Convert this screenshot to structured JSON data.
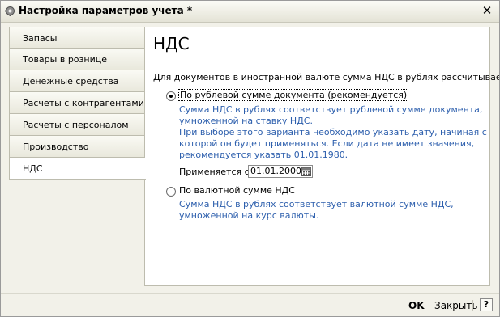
{
  "window": {
    "title": "Настройка параметров учета *",
    "icon": "gear-icon",
    "close_icon": "close-icon"
  },
  "tabs": [
    {
      "label": "Запасы"
    },
    {
      "label": "Товары в рознице"
    },
    {
      "label": "Денежные средства"
    },
    {
      "label": "Расчеты с контрагентами"
    },
    {
      "label": "Расчеты с персоналом"
    },
    {
      "label": "Производство"
    },
    {
      "label": "НДС",
      "active": true
    }
  ],
  "panel": {
    "title": "НДС",
    "question": "Для документов в иностранной валюте сумма НДС в рублях рассчитывается:",
    "options": [
      {
        "label": "По рублевой сумме документа (рекомендуется)",
        "selected": true,
        "desc": [
          "Сумма НДС в рублях соответствует рублевой сумме документа,",
          "умноженной на ставку НДС.",
          "При выборе этого варианта необходимо указать дату, начиная с",
          "которой он будет применяться. Если дата не имеет значения,",
          "рекомендуется указать 01.01.1980."
        ]
      },
      {
        "label": "По валютной сумме НДС",
        "selected": false,
        "desc": [
          "Сумма НДС в рублях соответствует валютной сумме НДС,",
          "умноженной на курс валюты."
        ]
      }
    ],
    "applies_from_label": "Применяется с:",
    "applies_from_value": "01.01.2000"
  },
  "footer": {
    "ok_label": "OK",
    "close_label": "Закрыть",
    "help_label": "?"
  },
  "colors": {
    "description_text": "#2d5fad",
    "window_bg": "#f2f1e9"
  }
}
